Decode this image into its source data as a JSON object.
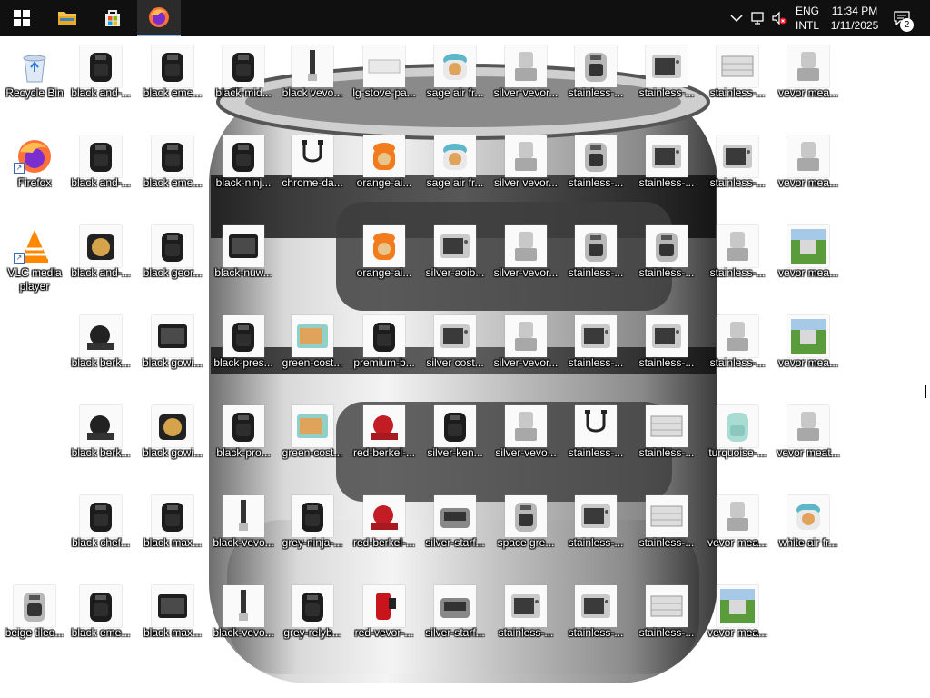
{
  "taskbar": {
    "pinned": [
      {
        "name": "start-button",
        "icon": "windows-logo-icon",
        "active": false
      },
      {
        "name": "file-explorer-button",
        "icon": "folder-icon",
        "active": false
      },
      {
        "name": "microsoft-store-button",
        "icon": "store-icon",
        "active": false
      },
      {
        "name": "firefox-taskbar-button",
        "icon": "firefox-icon",
        "active": true
      }
    ],
    "tray": {
      "lang_line1": "ENG",
      "lang_line2": "INTL",
      "time": "11:34 PM",
      "date": "1/11/2025",
      "notifications_count": "2"
    }
  },
  "desktop": {
    "wallpaper": "stainless air fryer",
    "icons": [
      {
        "label": "Recycle Bin",
        "kind": "recycle"
      },
      {
        "label": "black and-...",
        "kind": "fryer-black"
      },
      {
        "label": "black eme...",
        "kind": "fryer-black"
      },
      {
        "label": "black-mid...",
        "kind": "fryer-black"
      },
      {
        "label": "black vevo...",
        "kind": "blender"
      },
      {
        "label": "lg-stove-pa...",
        "kind": "panel"
      },
      {
        "label": "sage air fr...",
        "kind": "fryer-blue"
      },
      {
        "label": "silver-vevor...",
        "kind": "machine"
      },
      {
        "label": "stainless-...",
        "kind": "fryer-silver"
      },
      {
        "label": "stainless-...",
        "kind": "oven"
      },
      {
        "label": "stainless-...",
        "kind": "display"
      },
      {
        "label": "vevor mea...",
        "kind": "machine"
      },
      {
        "label": "Firefox",
        "kind": "firefox",
        "shortcut": true
      },
      {
        "label": "black and-...",
        "kind": "fryer-black"
      },
      {
        "label": "black eme...",
        "kind": "fryer-black"
      },
      {
        "label": "black-ninj...",
        "kind": "fryer-black"
      },
      {
        "label": "chrome-da...",
        "kind": "cable"
      },
      {
        "label": "orange-ai...",
        "kind": "fryer-orange"
      },
      {
        "label": "sage air fr...",
        "kind": "fryer-blue"
      },
      {
        "label": "silver vevor...",
        "kind": "machine"
      },
      {
        "label": "stainless-...",
        "kind": "fryer-silver"
      },
      {
        "label": "stainless-...",
        "kind": "oven"
      },
      {
        "label": "stainless-...",
        "kind": "oven"
      },
      {
        "label": "vevor mea...",
        "kind": "machine"
      },
      {
        "label": "VLC media player",
        "kind": "vlc",
        "shortcut": true
      },
      {
        "label": "black and-...",
        "kind": "fryer-food"
      },
      {
        "label": "black geor...",
        "kind": "fryer-black"
      },
      {
        "label": "black-nuw...",
        "kind": "oven-black"
      },
      {
        "label": "orange-ai...",
        "kind": "fryer-orange"
      },
      {
        "label": "silver-aoib...",
        "kind": "oven"
      },
      {
        "label": "silver-vevor...",
        "kind": "machine"
      },
      {
        "label": "stainless-...",
        "kind": "fryer-silver"
      },
      {
        "label": "stainless-...",
        "kind": "fryer-silver"
      },
      {
        "label": "stainless-...",
        "kind": "machine"
      },
      {
        "label": "vevor mea...",
        "kind": "field"
      },
      {
        "label": "black berk...",
        "kind": "slicer"
      },
      {
        "label": "black gowi...",
        "kind": "oven-black"
      },
      {
        "label": "black-pres...",
        "kind": "fryer-black"
      },
      {
        "label": "green-cost...",
        "kind": "oven-teal"
      },
      {
        "label": "premium-b...",
        "kind": "fryer-black"
      },
      {
        "label": "silver cost...",
        "kind": "oven"
      },
      {
        "label": "silver-vevor...",
        "kind": "machine"
      },
      {
        "label": "stainless-...",
        "kind": "oven"
      },
      {
        "label": "stainless-...",
        "kind": "oven"
      },
      {
        "label": "stainless-...",
        "kind": "machine"
      },
      {
        "label": "vevor mea...",
        "kind": "field"
      },
      {
        "label": "black berk...",
        "kind": "slicer"
      },
      {
        "label": "black gowi...",
        "kind": "fryer-food"
      },
      {
        "label": "black-pro...",
        "kind": "fryer-black"
      },
      {
        "label": "green-cost...",
        "kind": "oven-teal"
      },
      {
        "label": "red-berkel-...",
        "kind": "slicer-red"
      },
      {
        "label": "silver-ken...",
        "kind": "fryer-black"
      },
      {
        "label": "silver-vevo...",
        "kind": "machine"
      },
      {
        "label": "stainless-...",
        "kind": "cable"
      },
      {
        "label": "stainless-...",
        "kind": "display"
      },
      {
        "label": "turquoise-...",
        "kind": "fryer-teal"
      },
      {
        "label": "vevor meat...",
        "kind": "machine"
      },
      {
        "label": "black chef...",
        "kind": "fryer-black"
      },
      {
        "label": "black max...",
        "kind": "fryer-black"
      },
      {
        "label": "black-vevo...",
        "kind": "blender"
      },
      {
        "label": "grey-ninja-...",
        "kind": "fryer-black"
      },
      {
        "label": "red-berkel-...",
        "kind": "slicer-red"
      },
      {
        "label": "silver-starf...",
        "kind": "grill"
      },
      {
        "label": "space gre...",
        "kind": "fryer-silver"
      },
      {
        "label": "stainless-...",
        "kind": "oven"
      },
      {
        "label": "stainless-...",
        "kind": "display"
      },
      {
        "label": "vevor mea...",
        "kind": "machine"
      },
      {
        "label": "white air fr...",
        "kind": "fryer-blue"
      },
      {
        "label": "beige tileo...",
        "kind": "fryer-silver"
      },
      {
        "label": "black eme...",
        "kind": "fryer-black"
      },
      {
        "label": "black max...",
        "kind": "oven-black"
      },
      {
        "label": "black-vevo...",
        "kind": "blender"
      },
      {
        "label": "grey-relyb...",
        "kind": "fryer-black"
      },
      {
        "label": "red-vevor-...",
        "kind": "machine-red"
      },
      {
        "label": "silver-starf...",
        "kind": "grill"
      },
      {
        "label": "stainless-...",
        "kind": "oven"
      },
      {
        "label": "stainless-...",
        "kind": "oven"
      },
      {
        "label": "stainless-...",
        "kind": "display"
      },
      {
        "label": "vevor mea...",
        "kind": "field"
      }
    ]
  }
}
